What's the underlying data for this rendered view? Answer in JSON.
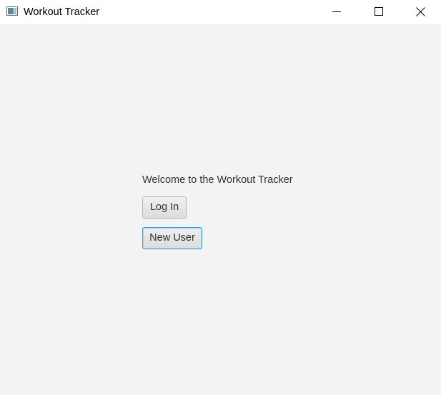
{
  "window": {
    "title": "Workout Tracker"
  },
  "main": {
    "welcome_text": "Welcome to the Workout Tracker",
    "login_label": "Log In",
    "new_user_label": "New User"
  },
  "colors": {
    "background": "#f3f3f3",
    "focus_border": "#3a9ee0"
  },
  "icons": {
    "app": "java-app-icon",
    "minimize": "minimize-icon",
    "maximize": "maximize-icon",
    "close": "close-icon"
  }
}
